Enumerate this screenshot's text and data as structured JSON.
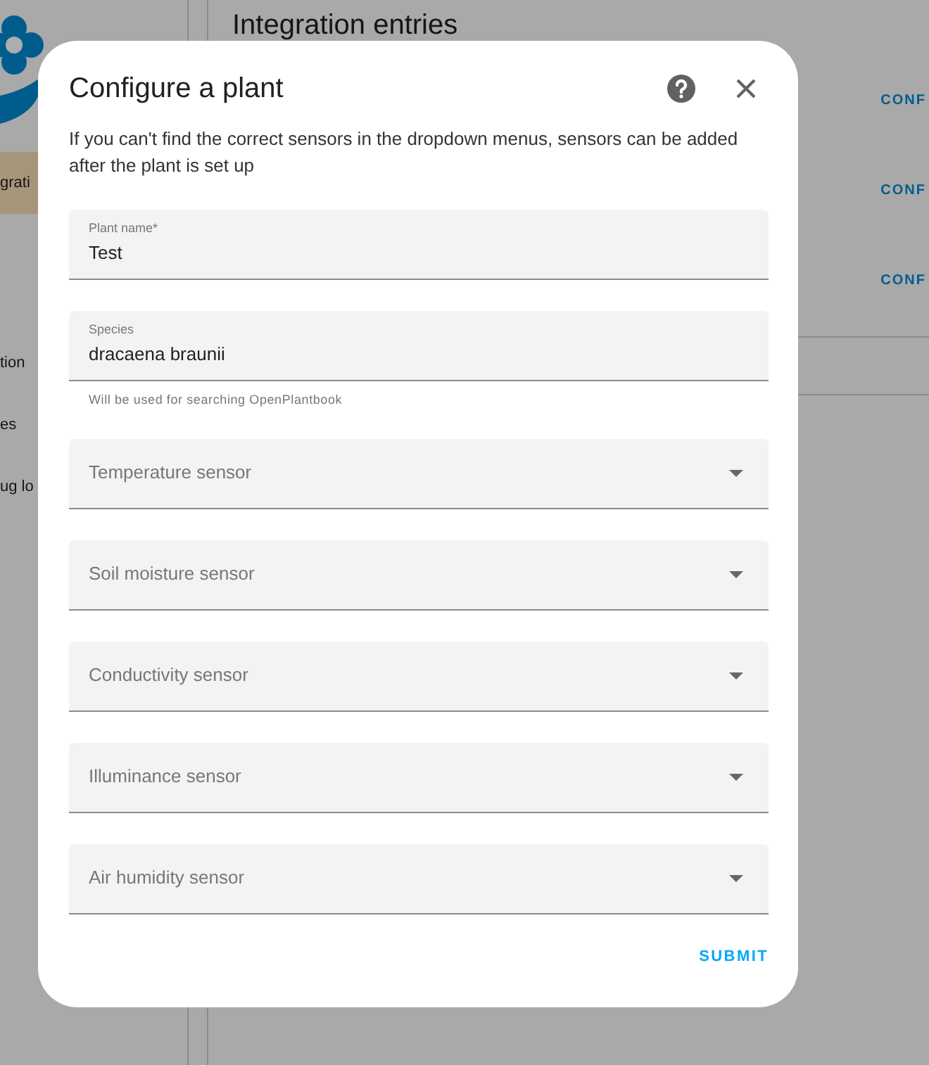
{
  "background": {
    "sidebar": {
      "items": [
        {
          "label": "grati",
          "selected": true
        },
        {
          "label": "tion",
          "selected": false
        },
        {
          "label": "es",
          "selected": false
        },
        {
          "label": "ug lo",
          "selected": false
        }
      ]
    },
    "heading": "Integration entries",
    "entry_actions": [
      "CONF",
      "CONF",
      "CONF"
    ]
  },
  "dialog": {
    "title": "Configure a plant",
    "description": "If you can't find the correct sensors in the dropdown menus, sensors can be added after the plant is set up",
    "fields": [
      {
        "kind": "text",
        "label": "Plant name*",
        "value": "Test"
      },
      {
        "kind": "text",
        "label": "Species",
        "value": "dracaena braunii",
        "helper": "Will be used for searching OpenPlantbook"
      },
      {
        "kind": "select",
        "label": "Temperature sensor"
      },
      {
        "kind": "select",
        "label": "Soil moisture sensor"
      },
      {
        "kind": "select",
        "label": "Conductivity sensor"
      },
      {
        "kind": "select",
        "label": "Illuminance sensor"
      },
      {
        "kind": "select",
        "label": "Air humidity sensor"
      }
    ],
    "submit": "SUBMIT"
  }
}
